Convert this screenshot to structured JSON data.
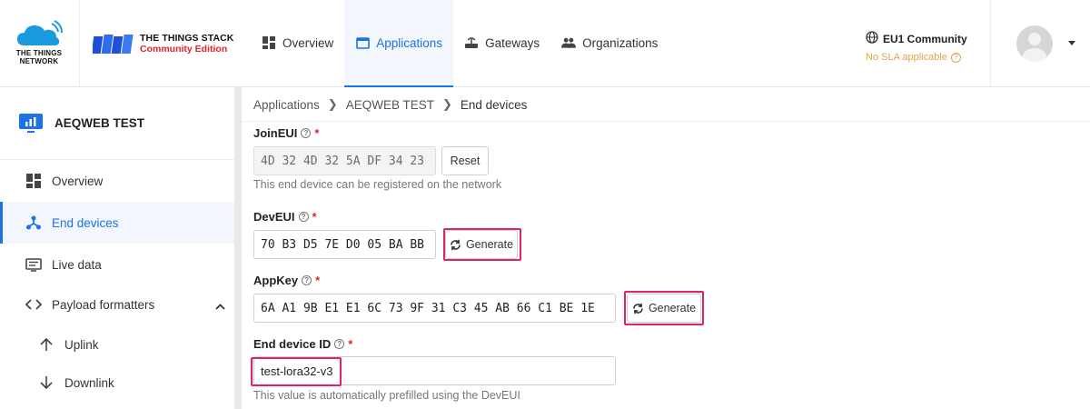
{
  "brand": {
    "ttn_line1": "THE THINGS",
    "ttn_line2": "NETWORK",
    "stack_title": "THE THINGS STACK",
    "stack_edition": "Community Edition"
  },
  "nav": {
    "items": [
      {
        "label": "Overview",
        "icon": "dashboard-icon"
      },
      {
        "label": "Applications",
        "icon": "application-icon",
        "active": true
      },
      {
        "label": "Gateways",
        "icon": "gateway-icon"
      },
      {
        "label": "Organizations",
        "icon": "organizations-icon"
      }
    ]
  },
  "cluster": {
    "name": "EU1 Community",
    "sla": "No SLA applicable"
  },
  "sidebar": {
    "app_name": "AEQWEB TEST",
    "items": [
      {
        "label": "Overview",
        "icon": "dashboard-icon"
      },
      {
        "label": "End devices",
        "icon": "end-devices-icon",
        "active": true
      },
      {
        "label": "Live data",
        "icon": "live-data-icon"
      },
      {
        "label": "Payload formatters",
        "icon": "code-icon"
      },
      {
        "label": "Uplink",
        "icon": "arrow-up-icon"
      },
      {
        "label": "Downlink",
        "icon": "arrow-down-icon"
      }
    ]
  },
  "breadcrumb": [
    "Applications",
    "AEQWEB TEST",
    "End devices"
  ],
  "form": {
    "joineui": {
      "label": "JoinEUI",
      "value": "4D 32 4D 32 5A DF 34 23",
      "reset_label": "Reset",
      "hint": "This end device can be registered on the network"
    },
    "deveui": {
      "label": "DevEUI",
      "value": "70 B3 D5 7E D0 05 BA BB",
      "generate_label": "Generate"
    },
    "appkey": {
      "label": "AppKey",
      "value": "6A A1 9B E1 E1 6C 73 9F 31 C3 45 AB 66 C1 BE 1E",
      "generate_label": "Generate"
    },
    "device_id": {
      "label": "End device ID",
      "value": "test-lora32-v3",
      "hint": "This value is automatically prefilled using the DevEUI"
    }
  },
  "colors": {
    "accent": "#1a73e8",
    "highlight": "#e0245e",
    "required": "#e1242c",
    "sla": "#e3a54a"
  }
}
